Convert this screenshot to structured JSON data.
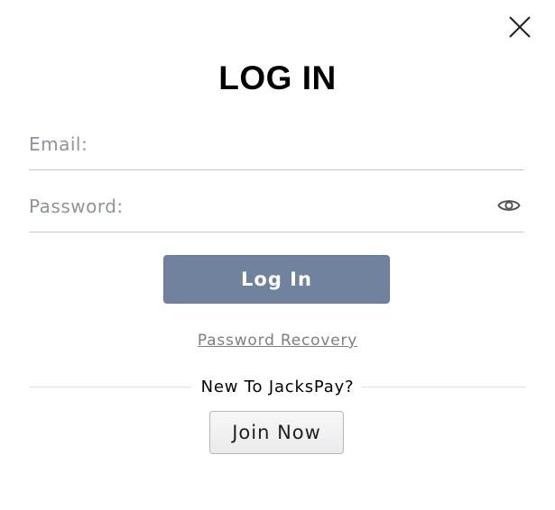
{
  "modal": {
    "title": "LOG IN",
    "close_icon": "close-icon"
  },
  "form": {
    "email_placeholder": "Email:",
    "email_value": "",
    "password_placeholder": "Password:",
    "password_value": "",
    "show_password_icon": "eye-icon",
    "login_label": "Log In",
    "recovery_label": "Password Recovery"
  },
  "signup": {
    "prompt": "New To JacksPay?",
    "join_label": "Join Now"
  },
  "colors": {
    "primary_button": "#71829e",
    "placeholder": "#8e939c",
    "link": "#7f7f7f",
    "divider": "#dedede"
  }
}
